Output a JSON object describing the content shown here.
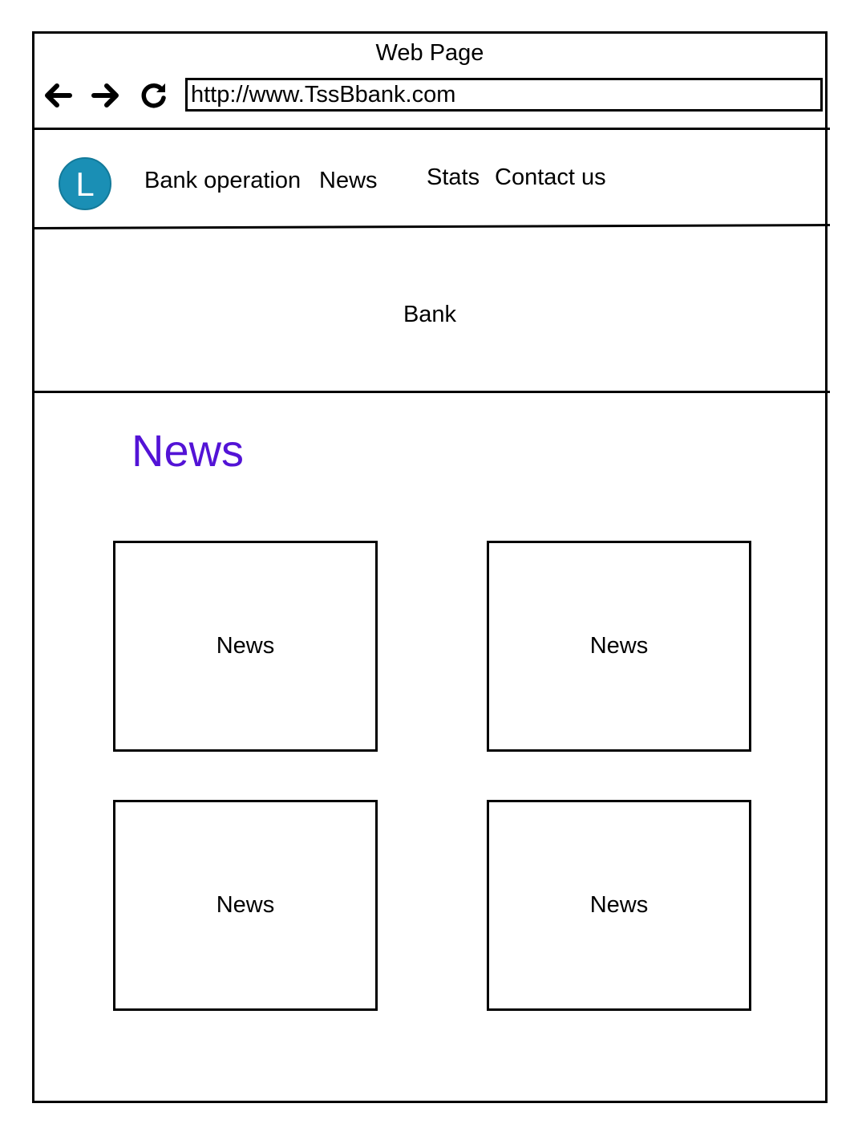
{
  "window": {
    "title": "Web Page"
  },
  "browser": {
    "back_icon": "arrow-left-icon",
    "forward_icon": "arrow-right-icon",
    "reload_icon": "reload-icon",
    "url": "http://www.TssBbank.com"
  },
  "navbar": {
    "logo_letter": "L",
    "logo_color": "#1a8fb5",
    "links": [
      {
        "label": "Bank operation"
      },
      {
        "label": "News"
      },
      {
        "label": "Stats"
      },
      {
        "label": "Contact us"
      }
    ]
  },
  "hero": {
    "title": "Bank"
  },
  "news_section": {
    "title": "News",
    "title_color": "#5313d6",
    "cards": [
      {
        "label": "News"
      },
      {
        "label": "News"
      },
      {
        "label": "News"
      },
      {
        "label": "News"
      }
    ]
  }
}
